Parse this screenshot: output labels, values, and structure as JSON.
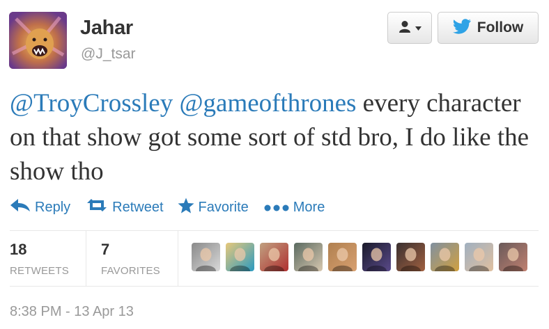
{
  "author": {
    "name": "Jahar",
    "handle": "@J_tsar",
    "avatar_icon": "lion-avatar"
  },
  "header": {
    "user_menu_icon": "user-dropdown-icon",
    "follow_label": "Follow",
    "follow_icon": "twitter-bird-icon"
  },
  "tweet": {
    "mention_1": "@TroyCrossley",
    "mention_2": "@gameofthrones",
    "body": " every character on that show got some sort of std bro, I do like the show tho"
  },
  "actions": {
    "reply": "Reply",
    "retweet": "Retweet",
    "favorite": "Favorite",
    "more": "More"
  },
  "stats": {
    "retweets_count": "18",
    "retweets_label": "RETWEETS",
    "favorites_count": "7",
    "favorites_label": "FAVORITES"
  },
  "favoriters": [
    {
      "colors": [
        "#8a8a8a",
        "#d9d9d9"
      ]
    },
    {
      "colors": [
        "#e8c87a",
        "#2a9ac0"
      ]
    },
    {
      "colors": [
        "#c0a080",
        "#b03030"
      ]
    },
    {
      "colors": [
        "#5a6a60",
        "#d8c8b0"
      ]
    },
    {
      "colors": [
        "#b08050",
        "#d8a070"
      ]
    },
    {
      "colors": [
        "#1a1a2a",
        "#5a4a8a"
      ]
    },
    {
      "colors": [
        "#3a3030",
        "#a06040"
      ]
    },
    {
      "colors": [
        "#8090a0",
        "#d0a040"
      ]
    },
    {
      "colors": [
        "#a0b0c0",
        "#e0c0a0"
      ]
    },
    {
      "colors": [
        "#6a5a5a",
        "#c08070"
      ]
    }
  ],
  "timestamp": "8:38 PM - 13 Apr 13",
  "colors": {
    "link": "#2b7bb9",
    "text": "#333333",
    "muted": "#999999",
    "twitter_blue": "#2fa3e6"
  }
}
